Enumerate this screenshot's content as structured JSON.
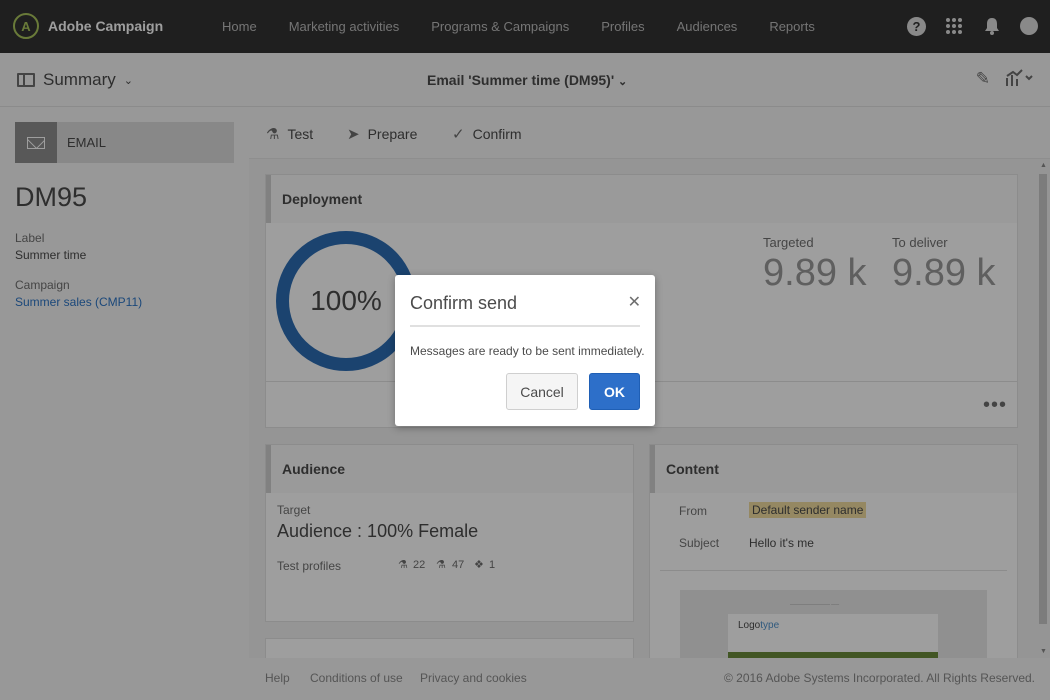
{
  "app": {
    "name": "Adobe Campaign",
    "logo_glyph": "A"
  },
  "nav": {
    "links": [
      "Home",
      "Marketing activities",
      "Programs & Campaigns",
      "Profiles",
      "Audiences",
      "Reports"
    ]
  },
  "subheader": {
    "summary_label": "Summary",
    "title": "Email 'Summer time (DM95)'"
  },
  "left": {
    "tile_label": "EMAIL",
    "code": "DM95",
    "label_caption": "Label",
    "label_value": "Summer time",
    "campaign_caption": "Campaign",
    "campaign_value": "Summer sales (CMP11)"
  },
  "toolbar": {
    "test": "Test",
    "prepare": "Prepare",
    "confirm": "Confirm"
  },
  "deployment": {
    "title": "Deployment",
    "percent": "100%",
    "targeted_label": "Targeted",
    "targeted_value": "9.89 k",
    "deliver_label": "To deliver",
    "deliver_value": "9.89 k",
    "more": "•••"
  },
  "audience": {
    "title": "Audience",
    "target_label": "Target",
    "target_value": "Audience : 100% Female",
    "test_profiles_label": "Test profiles",
    "count_a": "22",
    "count_b": "47",
    "count_c": "1"
  },
  "content": {
    "title": "Content",
    "from_label": "From",
    "from_value": "Default sender name",
    "subject_label": "Subject",
    "subject_value": "Hello it's me",
    "preview_logo_a": "Logo",
    "preview_logo_b": "type"
  },
  "footer": {
    "help": "Help",
    "conditions": "Conditions of use",
    "privacy": "Privacy and cookies",
    "copyright": "© 2016 Adobe Systems Incorporated. All Rights Reserved."
  },
  "dialog": {
    "title": "Confirm send",
    "message": "Messages are ready to be sent immediately.",
    "cancel": "Cancel",
    "ok": "OK"
  },
  "colors": {
    "accent_blue": "#2d6fc9",
    "topbar": "#323232",
    "logo_green": "#aac65c",
    "highlight": "#f0dc9e"
  }
}
